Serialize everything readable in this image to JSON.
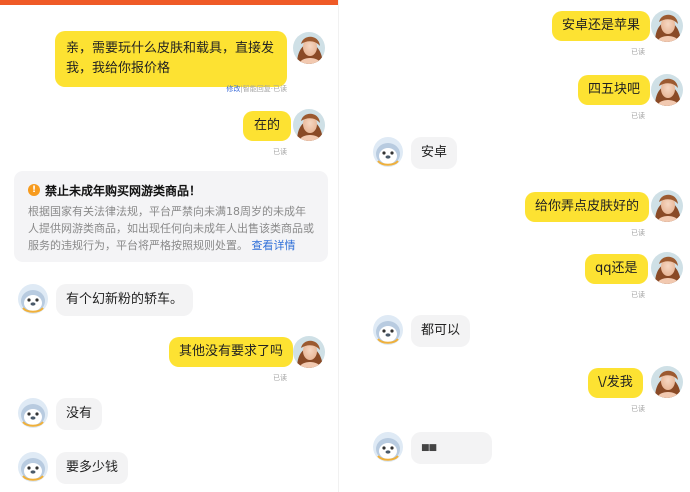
{
  "left_chat": {
    "messages": [
      {
        "text": "亲，需要玩什么皮肤和载具，直接发我，我给你报价格",
        "meta_edit": "修改",
        "meta_sep": "|",
        "meta_rest": "智能回复·已读"
      },
      {
        "text": "在的",
        "read": "已读"
      },
      {
        "text": "有个幻新粉的轿车。"
      },
      {
        "text": "其他没有要求了吗",
        "read": "已读"
      },
      {
        "text": "没有"
      },
      {
        "text": "要多少钱"
      }
    ],
    "notice": {
      "title": "禁止未成年购买网游类商品！",
      "body": "根据国家有关法律法规，平台严禁向未满18周岁的未成年人提供网游类商品，如出现任何向未成年人出售该类商品或服务的违规行为，平台将严格按照规则处置。",
      "link": "查看详情"
    }
  },
  "right_chat": {
    "messages": [
      {
        "text": "安卓还是苹果",
        "read": "已读"
      },
      {
        "text": "四五块吧",
        "read": "已读"
      },
      {
        "text": "安卓"
      },
      {
        "text": "给你弄点皮肤好的",
        "read": "已读"
      },
      {
        "text": "qq还是",
        "read": "已读"
      },
      {
        "text": "都可以"
      },
      {
        "text": "\\/发我",
        "read": "已读"
      },
      {
        "text": "■■"
      }
    ]
  },
  "colors": {
    "accent": "#ef5a27",
    "own_bubble": "#fde232",
    "other_bubble": "#f3f3f4",
    "link": "#2f6fd8",
    "warn": "#f79b1e"
  }
}
